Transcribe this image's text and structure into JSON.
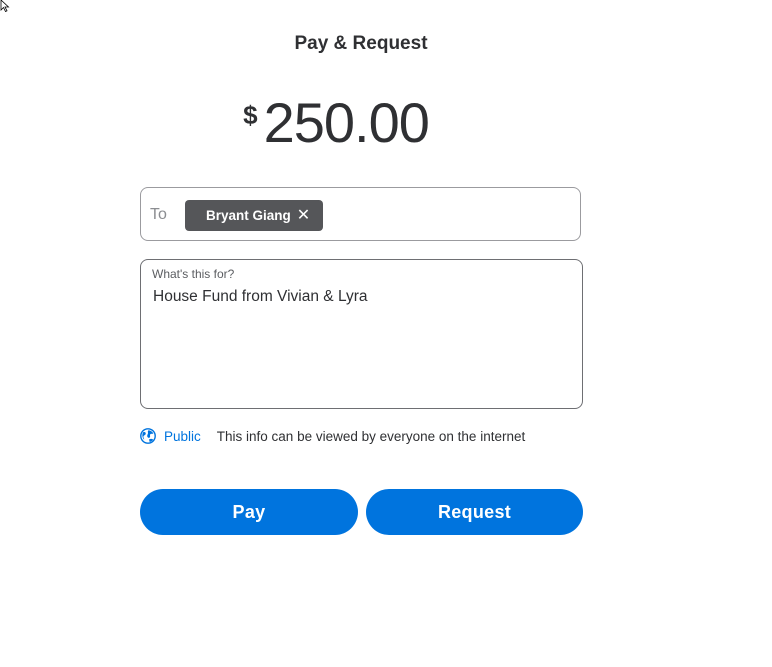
{
  "header": {
    "title": "Pay & Request"
  },
  "amount": {
    "currency_symbol": "$",
    "value": "250.00"
  },
  "to_field": {
    "label": "To",
    "recipients": [
      {
        "name": "Bryant Giang",
        "remove_glyph": "✕"
      }
    ]
  },
  "note": {
    "label": "What's this for?",
    "value": "House Fund from Vivian & Lyra"
  },
  "privacy": {
    "icon": "globe-icon",
    "setting": "Public",
    "description": "This info can be viewed by everyone on the internet"
  },
  "actions": {
    "pay_label": "Pay",
    "request_label": "Request"
  },
  "colors": {
    "accent": "#0074de",
    "chip_bg": "#555659",
    "text": "#2f3033"
  }
}
